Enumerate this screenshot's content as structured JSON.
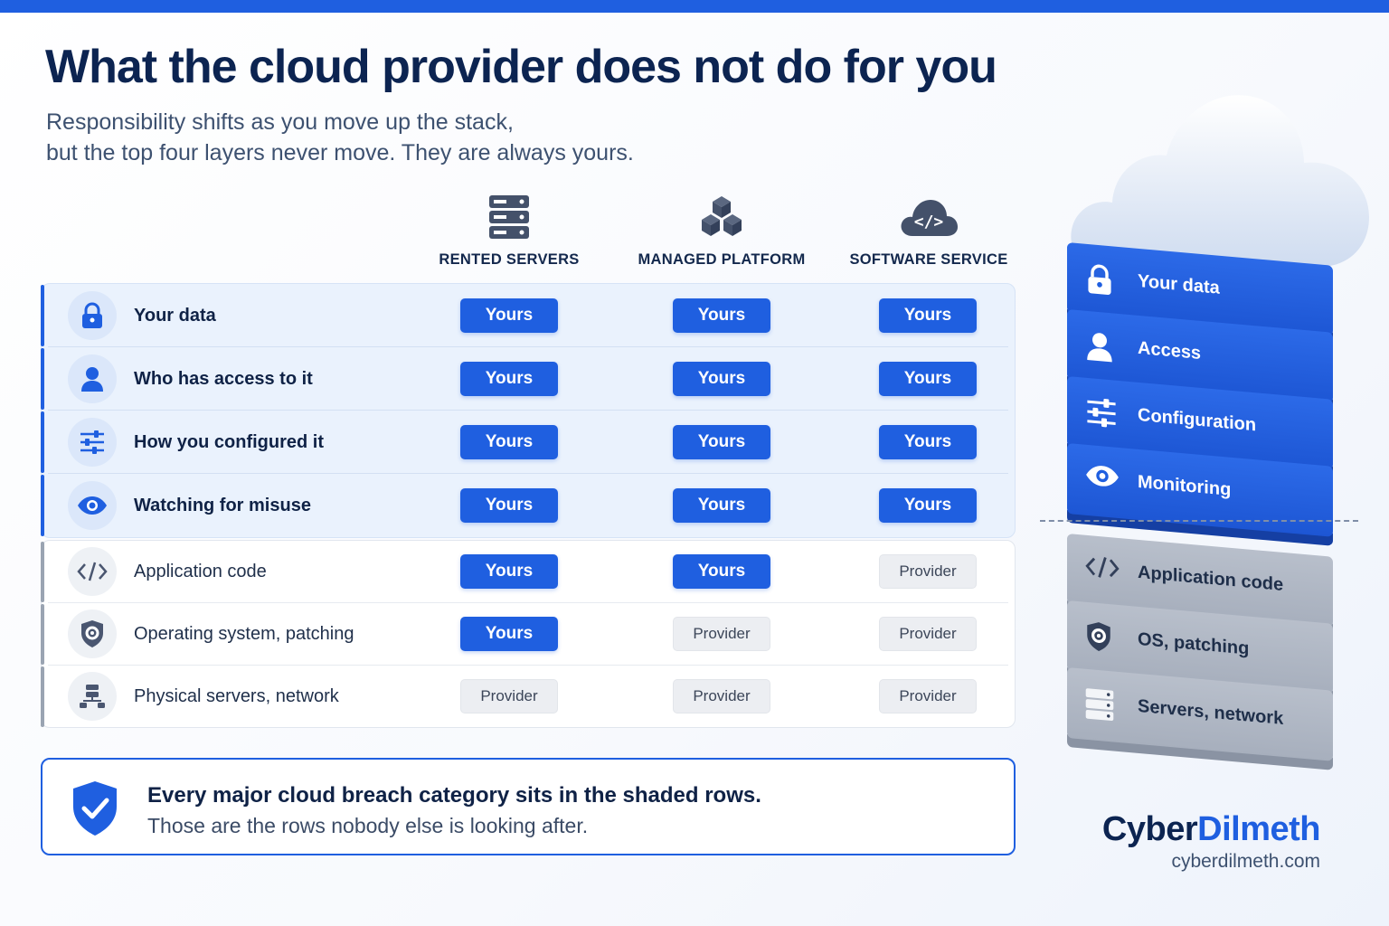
{
  "title": "What the cloud provider does not do for you",
  "subtitle": {
    "line1": "Responsibility shifts as you move up the stack,",
    "line2": "but the top four layers never move. They are always yours."
  },
  "columns": [
    {
      "label": "RENTED SERVERS",
      "icon": "server-rack-icon"
    },
    {
      "label": "MANAGED PLATFORM",
      "icon": "cubes-icon"
    },
    {
      "label": "SOFTWARE SERVICE",
      "icon": "cloud-code-icon"
    }
  ],
  "rows": [
    {
      "label": "Your data",
      "icon": "lock-icon",
      "shaded": true,
      "cells": [
        "Yours",
        "Yours",
        "Yours"
      ]
    },
    {
      "label": "Who has access to it",
      "icon": "user-icon",
      "shaded": true,
      "cells": [
        "Yours",
        "Yours",
        "Yours"
      ]
    },
    {
      "label": "How you configured it",
      "icon": "sliders-icon",
      "shaded": true,
      "cells": [
        "Yours",
        "Yours",
        "Yours"
      ]
    },
    {
      "label": "Watching for misuse",
      "icon": "eye-icon",
      "shaded": true,
      "cells": [
        "Yours",
        "Yours",
        "Yours"
      ]
    },
    {
      "label": "Application code",
      "icon": "code-icon",
      "shaded": false,
      "cells": [
        "Yours",
        "Yours",
        "Provider"
      ]
    },
    {
      "label": "Operating system, patching",
      "icon": "shield-gear-icon",
      "shaded": false,
      "cells": [
        "Yours",
        "Provider",
        "Provider"
      ]
    },
    {
      "label": "Physical servers, network",
      "icon": "network-icon",
      "shaded": false,
      "cells": [
        "Provider",
        "Provider",
        "Provider"
      ]
    }
  ],
  "callout": {
    "line1": "Every major cloud breach category sits in the shaded rows.",
    "line2": "Those are the rows nobody else is looking after.",
    "icon": "shield-check-icon"
  },
  "stack": {
    "blocks": [
      {
        "label": "Your data",
        "icon": "lock-icon",
        "tone": "blue"
      },
      {
        "label": "Access",
        "icon": "user-icon",
        "tone": "blue"
      },
      {
        "label": "Configuration",
        "icon": "sliders-icon",
        "tone": "blue"
      },
      {
        "label": "Monitoring",
        "icon": "eye-icon",
        "tone": "blue"
      },
      {
        "label": "Application code",
        "icon": "code-icon",
        "tone": "gray"
      },
      {
        "label": "OS, patching",
        "icon": "shield-gear-icon",
        "tone": "gray"
      },
      {
        "label": "Servers, network",
        "icon": "server-rack-icon",
        "tone": "gray"
      }
    ]
  },
  "brand": {
    "name_part1": "Cyber",
    "name_part2": "Dilmeth",
    "url": "cyberdilmeth.com"
  },
  "colors": {
    "accent": "#1f5fe0",
    "heading": "#0c2451",
    "provider_pill": "#eceef2"
  }
}
